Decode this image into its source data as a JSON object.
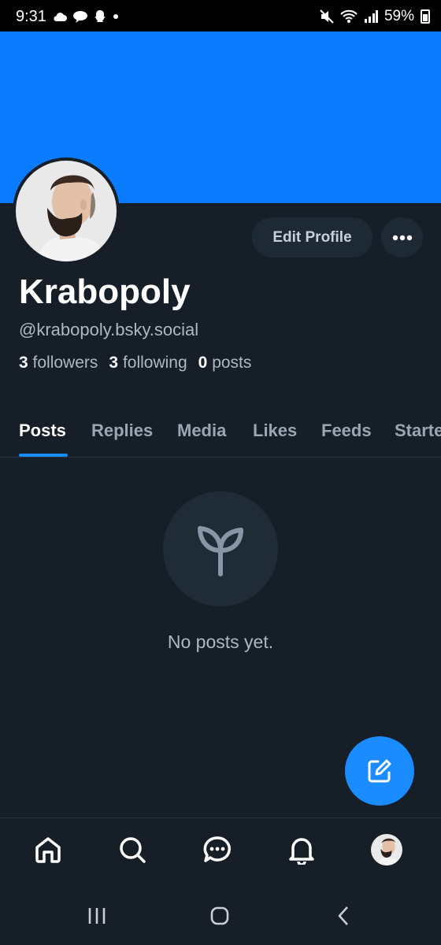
{
  "status_bar": {
    "time": "9:31",
    "battery": "59%"
  },
  "colors": {
    "banner": "#0a7aff",
    "accent": "#1a8cff",
    "background": "#161e27"
  },
  "profile": {
    "display_name": "Krabopoly",
    "handle": "@krabopoly.bsky.social",
    "followers_count": "3",
    "followers_label": "followers",
    "following_count": "3",
    "following_label": "following",
    "posts_count": "0",
    "posts_label": "posts",
    "edit_button": "Edit Profile"
  },
  "tabs": [
    {
      "label": "Posts",
      "active": true
    },
    {
      "label": "Replies",
      "active": false
    },
    {
      "label": "Media",
      "active": false
    },
    {
      "label": "Likes",
      "active": false
    },
    {
      "label": "Feeds",
      "active": false
    },
    {
      "label": "Starter Packs",
      "active": false
    }
  ],
  "empty_state": {
    "icon": "sprout-icon",
    "message": "No posts yet."
  },
  "fab": {
    "icon": "compose-icon"
  },
  "bottom_nav": [
    {
      "icon": "home-icon"
    },
    {
      "icon": "search-icon"
    },
    {
      "icon": "chat-icon"
    },
    {
      "icon": "bell-icon"
    },
    {
      "icon": "profile-avatar"
    }
  ],
  "system_nav": [
    {
      "icon": "recents-icon"
    },
    {
      "icon": "home-circle-icon"
    },
    {
      "icon": "back-icon"
    }
  ]
}
